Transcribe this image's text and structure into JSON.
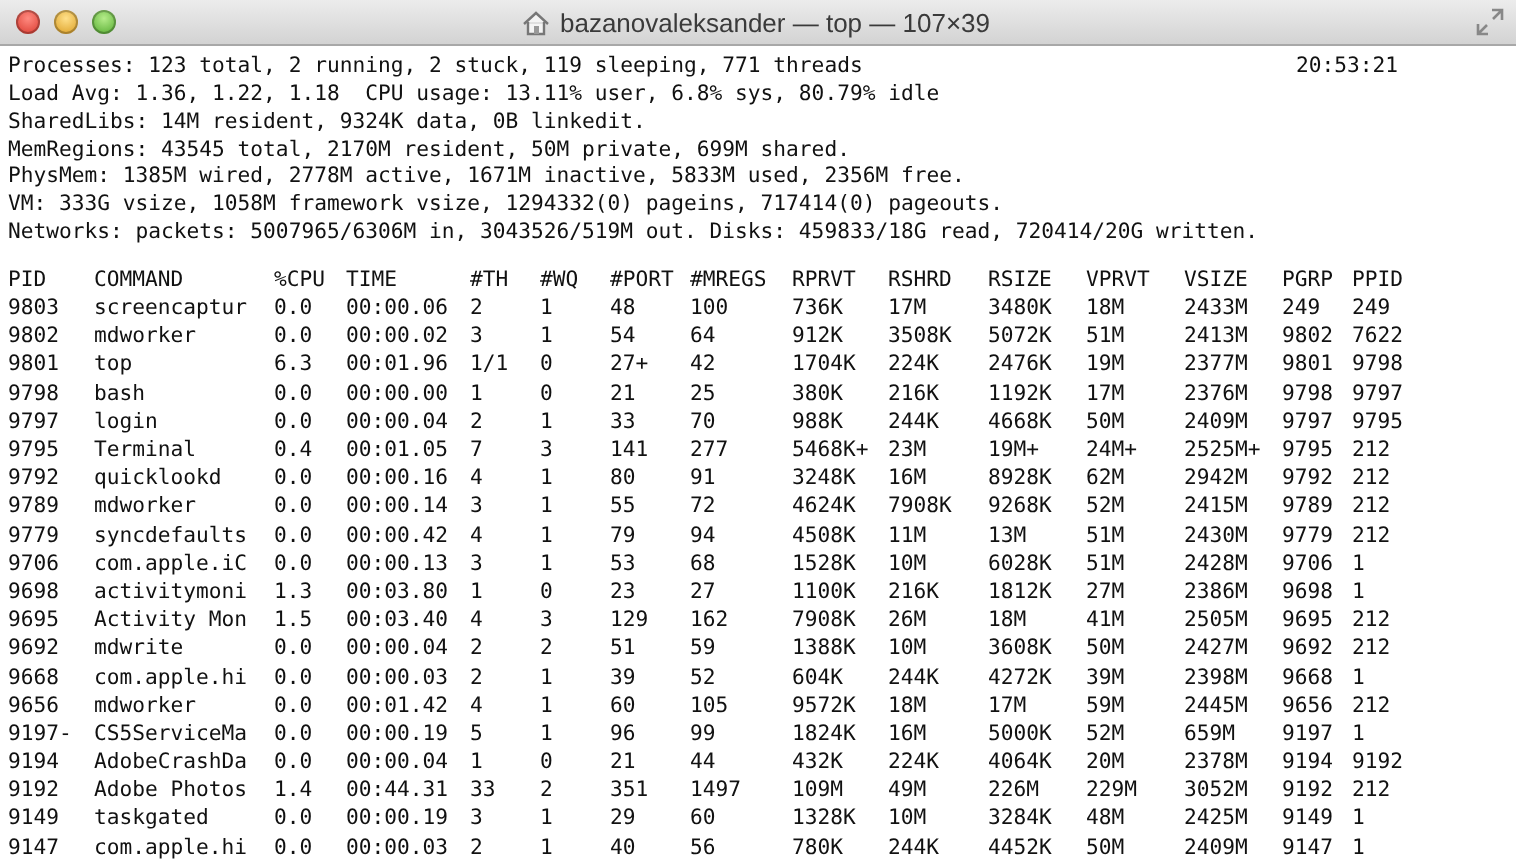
{
  "window": {
    "title": "bazanovaleksander — top — 107×39"
  },
  "summary": {
    "lines": [
      "Processes: 123 total, 2 running, 2 stuck, 119 sleeping, 771 threads",
      "Load Avg: 1.36, 1.22, 1.18  CPU usage: 13.11% user, 6.8% sys, 80.79% idle",
      "SharedLibs: 14M resident, 9324K data, 0B linkedit.",
      "MemRegions: 43545 total, 2170M resident, 50M private, 699M shared.",
      "PhysMem: 1385M wired, 2778M active, 1671M inactive, 5833M used, 2356M free.",
      "VM: 333G vsize, 1058M framework vsize, 1294332(0) pageins, 717414(0) pageouts.",
      "Networks: packets: 5007965/6306M in, 3043526/519M out. Disks: 459833/18G read, 720414/20G written."
    ],
    "clock": "20:53:21"
  },
  "table": {
    "columns": [
      "PID",
      "COMMAND",
      "%CPU",
      "TIME",
      "#TH",
      "#WQ",
      "#PORT",
      "#MREGS",
      "RPRVT",
      "RSHRD",
      "RSIZE",
      "VPRVT",
      "VSIZE",
      "PGRP",
      "PPID"
    ],
    "rows": [
      [
        "9803",
        "screencaptur",
        "0.0",
        "00:00.06",
        "2",
        "1",
        "48",
        "100",
        "736K",
        "17M",
        "3480K",
        "18M",
        "2433M",
        "249",
        "249"
      ],
      [
        "9802",
        "mdworker",
        "0.0",
        "00:00.02",
        "3",
        "1",
        "54",
        "64",
        "912K",
        "3508K",
        "5072K",
        "51M",
        "2413M",
        "9802",
        "7622"
      ],
      [
        "9801",
        "top",
        "6.3",
        "00:01.96",
        "1/1",
        "0",
        "27+",
        "42",
        "1704K",
        "224K",
        "2476K",
        "19M",
        "2377M",
        "9801",
        "9798"
      ],
      [
        "9798",
        "bash",
        "0.0",
        "00:00.00",
        "1",
        "0",
        "21",
        "25",
        "380K",
        "216K",
        "1192K",
        "17M",
        "2376M",
        "9798",
        "9797"
      ],
      [
        "9797",
        "login",
        "0.0",
        "00:00.04",
        "2",
        "1",
        "33",
        "70",
        "988K",
        "244K",
        "4668K",
        "50M",
        "2409M",
        "9797",
        "9795"
      ],
      [
        "9795",
        "Terminal",
        "0.4",
        "00:01.05",
        "7",
        "3",
        "141",
        "277",
        "5468K+",
        "23M",
        "19M+",
        "24M+",
        "2525M+",
        "9795",
        "212"
      ],
      [
        "9792",
        "quicklookd",
        "0.0",
        "00:00.16",
        "4",
        "1",
        "80",
        "91",
        "3248K",
        "16M",
        "8928K",
        "62M",
        "2942M",
        "9792",
        "212"
      ],
      [
        "9789",
        "mdworker",
        "0.0",
        "00:00.14",
        "3",
        "1",
        "55",
        "72",
        "4624K",
        "7908K",
        "9268K",
        "52M",
        "2415M",
        "9789",
        "212"
      ],
      [
        "9779",
        "syncdefaults",
        "0.0",
        "00:00.42",
        "4",
        "1",
        "79",
        "94",
        "4508K",
        "11M",
        "13M",
        "51M",
        "2430M",
        "9779",
        "212"
      ],
      [
        "9706",
        "com.apple.iC",
        "0.0",
        "00:00.13",
        "3",
        "1",
        "53",
        "68",
        "1528K",
        "10M",
        "6028K",
        "51M",
        "2428M",
        "9706",
        "1"
      ],
      [
        "9698",
        "activitymoni",
        "1.3",
        "00:03.80",
        "1",
        "0",
        "23",
        "27",
        "1100K",
        "216K",
        "1812K",
        "27M",
        "2386M",
        "9698",
        "1"
      ],
      [
        "9695",
        "Activity Mon",
        "1.5",
        "00:03.40",
        "4",
        "3",
        "129",
        "162",
        "7908K",
        "26M",
        "18M",
        "41M",
        "2505M",
        "9695",
        "212"
      ],
      [
        "9692",
        "mdwrite",
        "0.0",
        "00:00.04",
        "2",
        "2",
        "51",
        "59",
        "1388K",
        "10M",
        "3608K",
        "50M",
        "2427M",
        "9692",
        "212"
      ],
      [
        "9668",
        "com.apple.hi",
        "0.0",
        "00:00.03",
        "2",
        "1",
        "39",
        "52",
        "604K",
        "244K",
        "4272K",
        "39M",
        "2398M",
        "9668",
        "1"
      ],
      [
        "9656",
        "mdworker",
        "0.0",
        "00:01.42",
        "4",
        "1",
        "60",
        "105",
        "9572K",
        "18M",
        "17M",
        "59M",
        "2445M",
        "9656",
        "212"
      ],
      [
        "9197-",
        "CS5ServiceMa",
        "0.0",
        "00:00.19",
        "5",
        "1",
        "96",
        "99",
        "1824K",
        "16M",
        "5000K",
        "52M",
        "659M",
        "9197",
        "1"
      ],
      [
        "9194",
        "AdobeCrashDa",
        "0.0",
        "00:00.04",
        "1",
        "0",
        "21",
        "44",
        "432K",
        "224K",
        "4064K",
        "20M",
        "2378M",
        "9194",
        "9192"
      ],
      [
        "9192",
        "Adobe Photos",
        "1.4",
        "00:44.31",
        "33",
        "2",
        "351",
        "1497",
        "109M",
        "49M",
        "226M",
        "229M",
        "3052M",
        "9192",
        "212"
      ],
      [
        "9149",
        "taskgated",
        "0.0",
        "00:00.19",
        "3",
        "1",
        "29",
        "60",
        "1328K",
        "10M",
        "3284K",
        "48M",
        "2425M",
        "9149",
        "1"
      ],
      [
        "9147",
        "com.apple.hi",
        "0.0",
        "00:00.03",
        "2",
        "1",
        "40",
        "56",
        "780K",
        "244K",
        "4452K",
        "50M",
        "2409M",
        "9147",
        "1"
      ]
    ]
  }
}
